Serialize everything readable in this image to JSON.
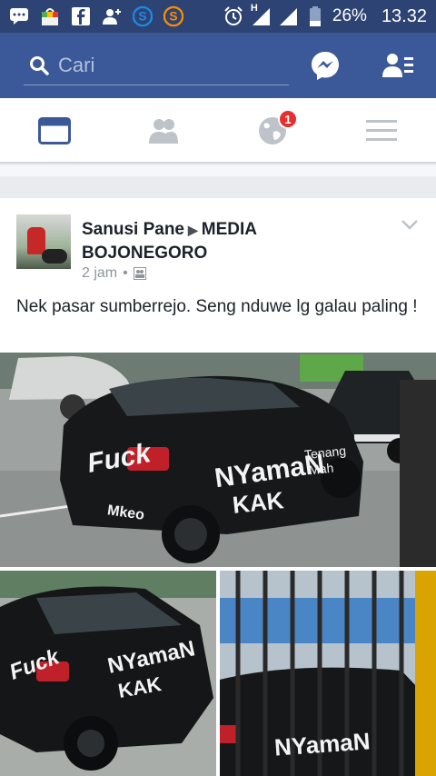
{
  "status_bar": {
    "battery": "26%",
    "time": "13.32",
    "network": "H",
    "icons": [
      "chat-icon",
      "store-icon",
      "facebook-icon",
      "person-add-icon",
      "s-app-blue-icon",
      "s-app-orange-icon",
      "alarm-icon",
      "signal-icon",
      "signal-icon",
      "battery-icon"
    ]
  },
  "topbar": {
    "search_placeholder": "Cari",
    "icons": [
      "search-icon",
      "messenger-icon",
      "friend-list-icon"
    ],
    "color": "#3b5998"
  },
  "navbar": {
    "tabs": [
      {
        "name": "news-feed-tab",
        "icon": "news-feed-icon",
        "active": true
      },
      {
        "name": "friends-tab",
        "icon": "friends-icon",
        "active": false
      },
      {
        "name": "notifications-tab",
        "icon": "globe-icon",
        "active": false,
        "badge": "1"
      },
      {
        "name": "menu-tab",
        "icon": "hamburger-icon",
        "active": false
      }
    ],
    "accent": "#3b5998",
    "badge_color": "#e62e2e"
  },
  "post": {
    "author": "Sanusi Pane",
    "group": "MEDIA BOJONEGORO",
    "time": "2 jam",
    "separator": "•",
    "privacy_icon": "group-privacy-icon",
    "text": "Nek pasar sumberrejo. Seng nduwe lg galau paling !",
    "photos": [
      {
        "name": "photo-main",
        "graffiti": [
          "Fuck",
          "NYamaN",
          "KAK",
          "Mah",
          "Tenang",
          "Mkeo"
        ]
      },
      {
        "name": "photo-left",
        "graffiti": [
          "Fuck",
          "NYamaN",
          "KAK"
        ]
      },
      {
        "name": "photo-right",
        "graffiti": [
          "NYamaN"
        ]
      }
    ]
  }
}
